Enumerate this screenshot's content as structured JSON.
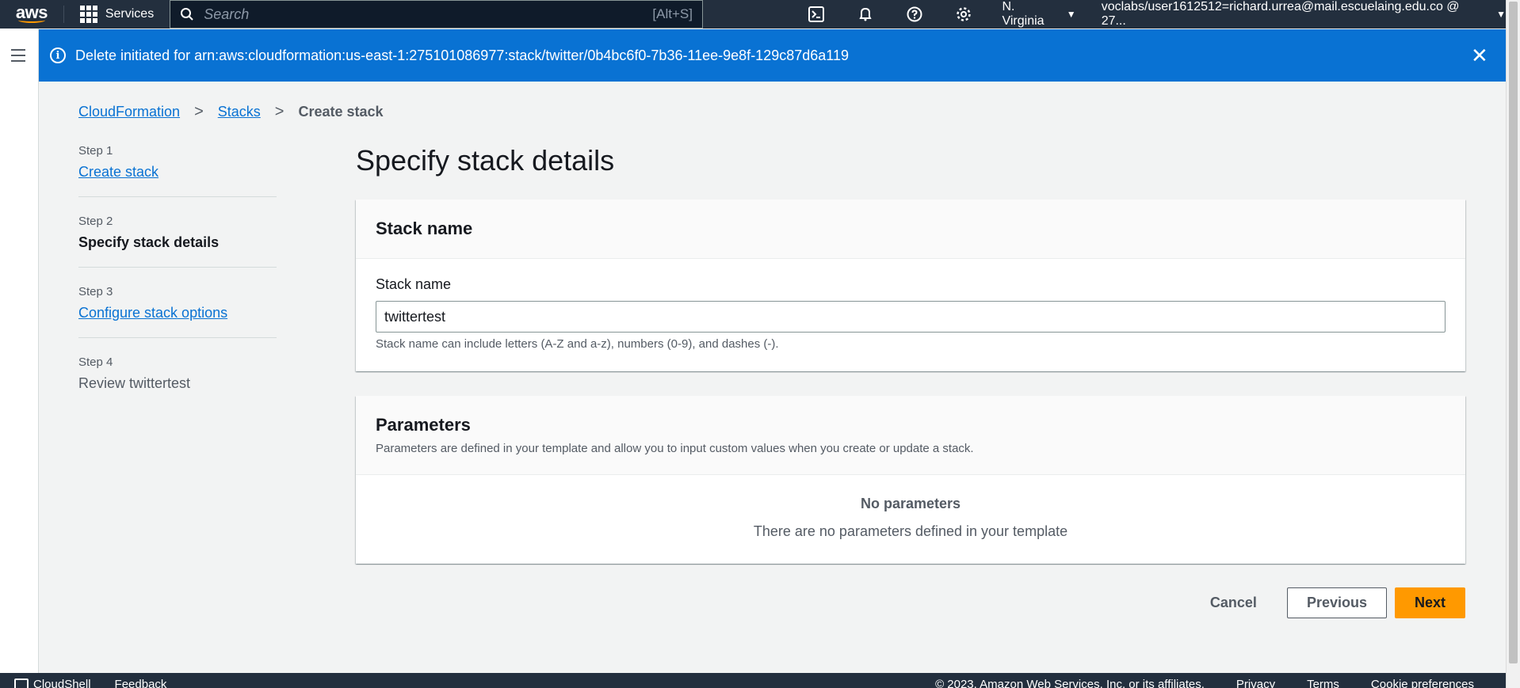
{
  "topnav": {
    "logo": "aws",
    "services_label": "Services",
    "search_placeholder": "Search",
    "search_shortcut": "[Alt+S]",
    "icons": [
      "cloudshell-icon",
      "bell-icon",
      "help-icon",
      "gear-icon"
    ],
    "region": "N. Virginia",
    "account": "voclabs/user1612512=richard.urrea@mail.escuelaing.edu.co @ 27..."
  },
  "flash": {
    "message": "Delete initiated for arn:aws:cloudformation:us-east-1:275101086977:stack/twitter/0b4bc6f0-7b36-11ee-9e8f-129c87d6a119",
    "color": "#0972d3"
  },
  "breadcrumb": {
    "items": [
      "CloudFormation",
      "Stacks"
    ],
    "current": "Create stack"
  },
  "steps": [
    {
      "number": "Step 1",
      "label": "Create stack"
    },
    {
      "number": "Step 2",
      "label": "Specify stack details"
    },
    {
      "number": "Step 3",
      "label": "Configure stack options"
    },
    {
      "number": "Step 4",
      "label": "Review twittertest"
    }
  ],
  "page": {
    "title": "Specify stack details"
  },
  "stack_name_card": {
    "header": "Stack name",
    "field_label": "Stack name",
    "value": "twittertest",
    "hint": "Stack name can include letters (A-Z and a-z), numbers (0-9), and dashes (-)."
  },
  "parameters_card": {
    "header": "Parameters",
    "description": "Parameters are defined in your template and allow you to input custom values when you create or update a stack.",
    "empty_title": "No parameters",
    "empty_text": "There are no parameters defined in your template"
  },
  "actions": {
    "cancel": "Cancel",
    "previous": "Previous",
    "next": "Next",
    "primary_color": "#ff9900"
  },
  "footer": {
    "cloudshell": "CloudShell",
    "feedback": "Feedback",
    "copyright": "© 2023, Amazon Web Services, Inc. or its affiliates.",
    "privacy": "Privacy",
    "terms": "Terms",
    "cookies": "Cookie preferences"
  }
}
